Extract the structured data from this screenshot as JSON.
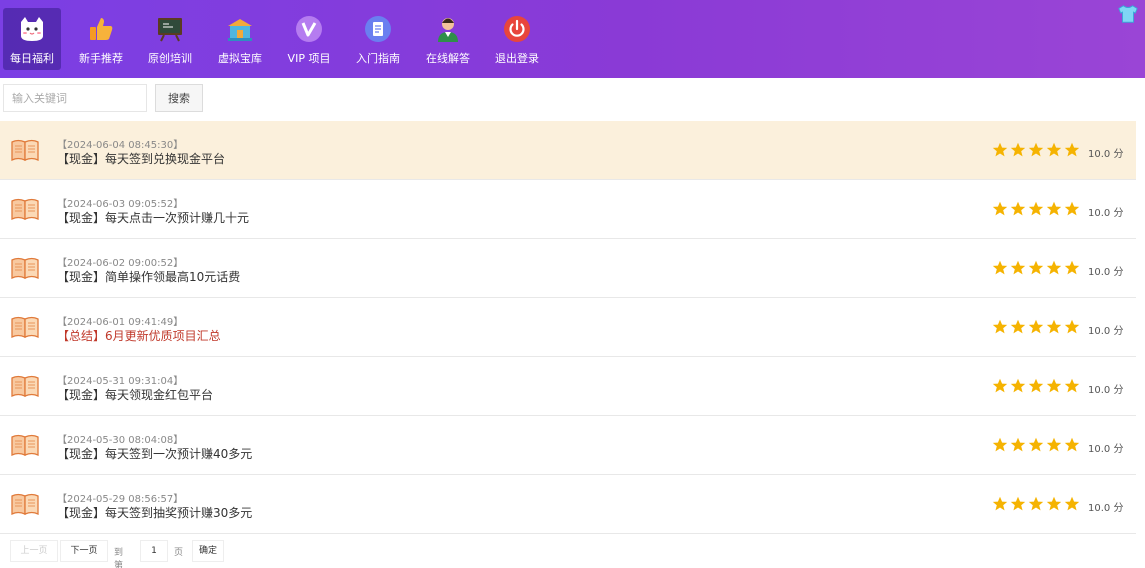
{
  "nav": {
    "items": [
      {
        "label": "每日福利",
        "icon": "cat-icon",
        "active": true
      },
      {
        "label": "新手推荐",
        "icon": "thumbs-up-icon",
        "active": false
      },
      {
        "label": "原创培训",
        "icon": "blackboard-icon",
        "active": false
      },
      {
        "label": "虚拟宝库",
        "icon": "treasure-icon",
        "active": false
      },
      {
        "label": "VIP 项目",
        "icon": "vip-icon",
        "active": false
      },
      {
        "label": "入门指南",
        "icon": "guide-icon",
        "active": false
      },
      {
        "label": "在线解答",
        "icon": "support-agent-icon",
        "active": false
      },
      {
        "label": "退出登录",
        "icon": "power-icon",
        "active": false
      }
    ]
  },
  "search": {
    "placeholder": "输入关键词",
    "button_label": "搜索"
  },
  "list": {
    "items": [
      {
        "date": "【2024-06-04 08:45:30】",
        "title": "【现金】每天签到兑换现金平台",
        "rating": 5,
        "score": "10.0 分",
        "highlight": true,
        "red": false
      },
      {
        "date": "【2024-06-03 09:05:52】",
        "title": "【现金】每天点击一次预计赚几十元",
        "rating": 5,
        "score": "10.0 分",
        "highlight": false,
        "red": false
      },
      {
        "date": "【2024-06-02 09:00:52】",
        "title": "【现金】简单操作领最高10元话费",
        "rating": 5,
        "score": "10.0 分",
        "highlight": false,
        "red": false
      },
      {
        "date": "【2024-06-01 09:41:49】",
        "title": "【总结】6月更新优质项目汇总",
        "rating": 5,
        "score": "10.0 分",
        "highlight": false,
        "red": true
      },
      {
        "date": "【2024-05-31 09:31:04】",
        "title": "【现金】每天领现金红包平台",
        "rating": 5,
        "score": "10.0 分",
        "highlight": false,
        "red": false
      },
      {
        "date": "【2024-05-30 08:04:08】",
        "title": "【现金】每天签到一次预计赚40多元",
        "rating": 5,
        "score": "10.0 分",
        "highlight": false,
        "red": false
      },
      {
        "date": "【2024-05-29 08:56:57】",
        "title": "【现金】每天签到抽奖预计赚30多元",
        "rating": 5,
        "score": "10.0 分",
        "highlight": false,
        "red": false
      }
    ]
  },
  "pager": {
    "prev_label": "上一页",
    "next_label": "下一页",
    "goto_label": "到第",
    "page_value": "1",
    "page_unit": "页",
    "confirm_label": "确定"
  },
  "colors": {
    "nav_start": "#7b3fe4",
    "nav_end": "#9a45d6",
    "star": "#f5b301",
    "highlight_row": "#fbf0dc",
    "red_title": "#c0392b"
  }
}
